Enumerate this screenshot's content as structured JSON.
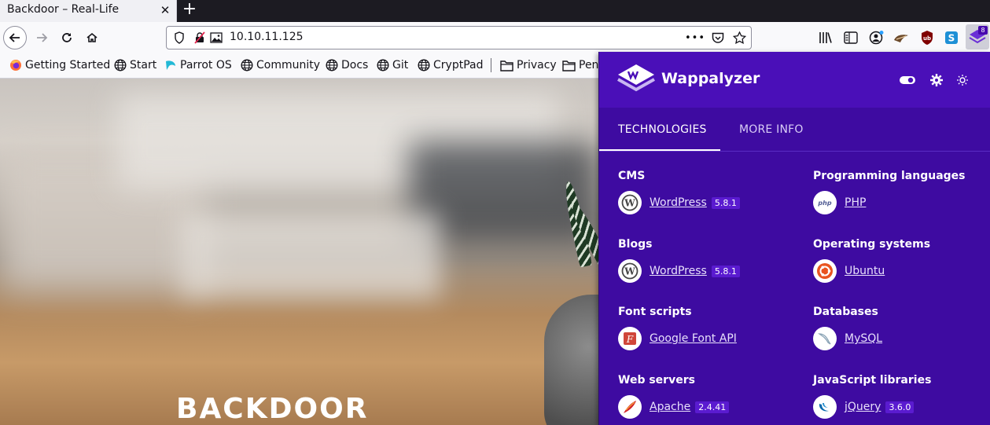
{
  "tab": {
    "title": "Backdoor – Real-Life",
    "close_glyph": "✕",
    "new_tab_glyph": "+"
  },
  "address_bar": {
    "url": "10.10.11.125",
    "menu_glyph": "•••"
  },
  "toolbar": {
    "extension_badge": "8"
  },
  "bookmarks": [
    {
      "label": "Getting Started",
      "icon": "firefox-icon"
    },
    {
      "label": "Start",
      "icon": "globe-icon"
    },
    {
      "label": "Parrot OS",
      "icon": "parrot-icon"
    },
    {
      "label": "Community",
      "icon": "globe-icon"
    },
    {
      "label": "Docs",
      "icon": "globe-icon"
    },
    {
      "label": "Git",
      "icon": "globe-icon"
    },
    {
      "label": "CryptPad",
      "icon": "globe-icon"
    },
    {
      "label": "Privacy",
      "icon": "folder-icon"
    },
    {
      "label": "Pen",
      "icon": "folder-icon"
    }
  ],
  "page": {
    "site_title": "BACKDOOR"
  },
  "wappalyzer": {
    "name": "Wappalyzer",
    "tabs": [
      "TECHNOLOGIES",
      "MORE INFO"
    ],
    "categories": [
      {
        "name": "CMS",
        "tech": {
          "name": "WordPress",
          "version": "5.8.1",
          "icon": "wordpress-icon"
        }
      },
      {
        "name": "Programming languages",
        "tech": {
          "name": "PHP",
          "version": "",
          "icon": "php-icon"
        }
      },
      {
        "name": "Blogs",
        "tech": {
          "name": "WordPress",
          "version": "5.8.1",
          "icon": "wordpress-icon"
        }
      },
      {
        "name": "Operating systems",
        "tech": {
          "name": "Ubuntu",
          "version": "",
          "icon": "ubuntu-icon"
        }
      },
      {
        "name": "Font scripts",
        "tech": {
          "name": "Google Font API",
          "version": "",
          "icon": "google-font-icon"
        }
      },
      {
        "name": "Databases",
        "tech": {
          "name": "MySQL",
          "version": "",
          "icon": "mysql-icon"
        }
      },
      {
        "name": "Web servers",
        "tech": {
          "name": "Apache",
          "version": "2.4.41",
          "icon": "apache-icon"
        }
      },
      {
        "name": "JavaScript libraries",
        "tech": {
          "name": "jQuery",
          "version": "3.6.0",
          "icon": "jquery-icon"
        }
      }
    ],
    "colors": {
      "header": "#4a0fb8",
      "body": "#3e0ba1",
      "version_badge": "#5a1bd0"
    }
  }
}
